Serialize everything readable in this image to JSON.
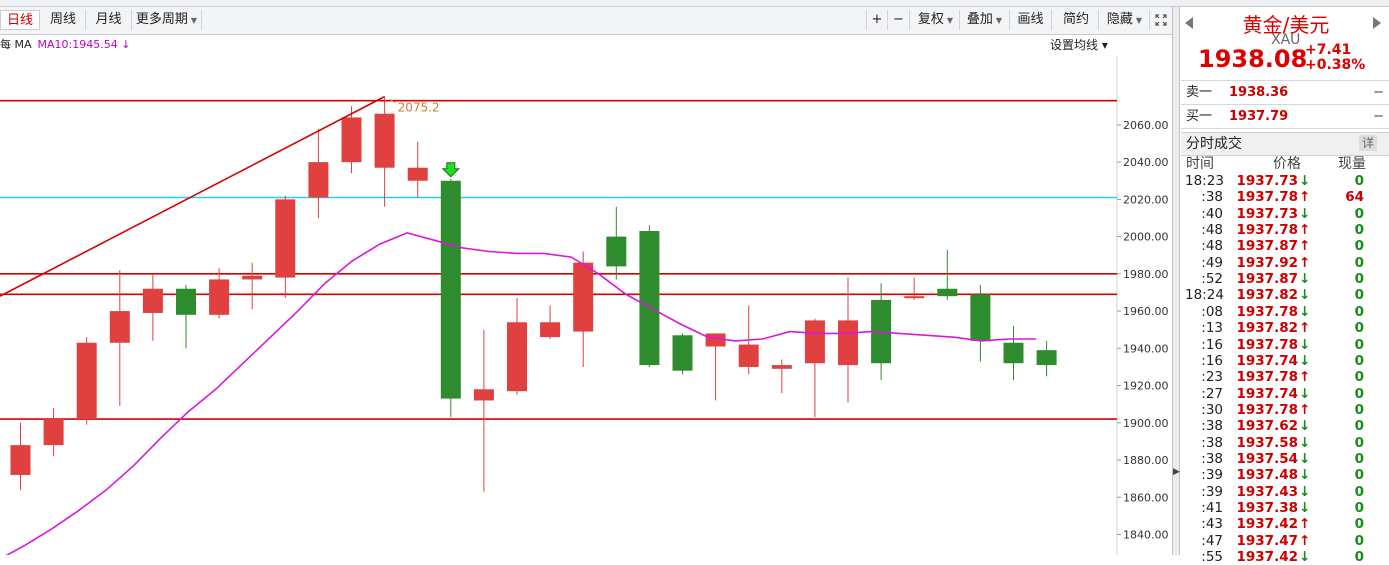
{
  "toolbar": {
    "tabs": [
      {
        "label": "日线",
        "active": true
      },
      {
        "label": "周线",
        "active": false
      },
      {
        "label": "月线",
        "active": false
      }
    ],
    "more_period": "更多周期",
    "zoom_in": "+",
    "zoom_out": "−",
    "fuquan": "复权",
    "diejia": "叠加",
    "draw": "画线",
    "simple": "简约",
    "hide": "隐藏"
  },
  "legend": {
    "prefix": "每 MA",
    "ma10": "MA10:1945.54 ↓"
  },
  "set_ma_label": "设置均线 ▾",
  "chart_data": {
    "type": "candlestick",
    "yaxis_ticks": [
      "2060.00",
      "2040.00",
      "2020.00",
      "2000.00",
      "1980.00",
      "1960.00",
      "1940.00",
      "1920.00",
      "1900.00",
      "1880.00",
      "1860.00",
      "1840.00"
    ],
    "ylim": [
      1829,
      2097
    ],
    "annotation_high": "2075.2",
    "candles": [
      {
        "o": 1872,
        "h": 1900,
        "l": 1864,
        "c": 1888
      },
      {
        "o": 1888,
        "h": 1908,
        "l": 1882,
        "c": 1902
      },
      {
        "o": 1902,
        "h": 1946,
        "l": 1899,
        "c": 1943
      },
      {
        "o": 1943,
        "h": 1982,
        "l": 1909,
        "c": 1960
      },
      {
        "o": 1959,
        "h": 1980,
        "l": 1944,
        "c": 1972
      },
      {
        "o": 1972,
        "h": 1974,
        "l": 1940,
        "c": 1958
      },
      {
        "o": 1958,
        "h": 1983,
        "l": 1956,
        "c": 1977
      },
      {
        "o": 1977,
        "h": 1986,
        "l": 1961,
        "c": 1979
      },
      {
        "o": 1978,
        "h": 2022,
        "l": 1967,
        "c": 2020
      },
      {
        "o": 2021,
        "h": 2058,
        "l": 2010,
        "c": 2040
      },
      {
        "o": 2040,
        "h": 2070,
        "l": 2034,
        "c": 2064
      },
      {
        "o": 2037,
        "h": 2075.2,
        "l": 2016,
        "c": 2066
      },
      {
        "o": 2030,
        "h": 2051,
        "l": 2021,
        "c": 2037
      },
      {
        "o": 2030,
        "h": 2031,
        "l": 1903,
        "c": 1913
      },
      {
        "o": 1912,
        "h": 1950,
        "l": 1863,
        "c": 1918
      },
      {
        "o": 1917,
        "h": 1967,
        "l": 1915,
        "c": 1954
      },
      {
        "o": 1946,
        "h": 1963,
        "l": 1945,
        "c": 1954
      },
      {
        "o": 1949,
        "h": 1992,
        "l": 1930,
        "c": 1986
      },
      {
        "o": 2000,
        "h": 2016,
        "l": 1977,
        "c": 1984
      },
      {
        "o": 2003,
        "h": 2006,
        "l": 1930,
        "c": 1931
      },
      {
        "o": 1947,
        "h": 1948,
        "l": 1926,
        "c": 1928
      },
      {
        "o": 1941,
        "h": 1948,
        "l": 1912,
        "c": 1948
      },
      {
        "o": 1930,
        "h": 1963,
        "l": 1926,
        "c": 1942
      },
      {
        "o": 1929,
        "h": 1934,
        "l": 1916,
        "c": 1931
      },
      {
        "o": 1932,
        "h": 1956,
        "l": 1903,
        "c": 1955
      },
      {
        "o": 1931,
        "h": 1978,
        "l": 1911,
        "c": 1955
      },
      {
        "o": 1966,
        "h": 1975,
        "l": 1923,
        "c": 1932
      },
      {
        "o": 1968,
        "h": 1978,
        "l": 1966,
        "c": 1968
      },
      {
        "o": 1972,
        "h": 1993,
        "l": 1966,
        "c": 1968
      },
      {
        "o": 1969,
        "h": 1974,
        "l": 1933,
        "c": 1944
      },
      {
        "o": 1943,
        "h": 1952,
        "l": 1923,
        "c": 1932
      },
      {
        "o": 1939,
        "h": 1944,
        "l": 1925,
        "c": 1931
      }
    ],
    "ma10": [
      1826,
      1834,
      1843,
      1853,
      1864,
      1877,
      1892,
      1906,
      1918,
      1932,
      1946,
      1960,
      1975,
      1987,
      1996,
      2002,
      1998,
      1994,
      1992,
      1991,
      1991,
      1989,
      1980,
      1969,
      1961,
      1953,
      1946,
      1944,
      1945,
      1949,
      1948,
      1948,
      1949,
      1948,
      1947,
      1946,
      1944,
      1945,
      1945
    ],
    "hlines": [
      2073,
      2021,
      1980,
      1969,
      1902
    ],
    "hline_colors": [
      "#d40000",
      "#21d5e6",
      "#d40000",
      "#d40000",
      "#d40000"
    ],
    "trendline": [
      1968,
      2075.2
    ]
  },
  "colors": {
    "up": "#e04040",
    "down": "#2e8b2e",
    "ma": "#d81ad8",
    "trend": "#d40000"
  },
  "panel": {
    "title": "黄金/美元",
    "code": "XAU",
    "price": "1938.08",
    "change": "+7.41",
    "change_pct": "+0.38%",
    "sell_label": "卖一",
    "sell_price": "1938.36",
    "sell_vol": "−",
    "buy_label": "买一",
    "buy_price": "1937.79",
    "buy_vol": "−",
    "trades_title": "分时成交",
    "detail": "详",
    "col_time": "时间",
    "col_price": "价格",
    "col_vol": "现量",
    "trades": [
      {
        "t": "18:23",
        "p": "1937.73",
        "d": "down",
        "v": "0"
      },
      {
        "t": ":38",
        "p": "1937.78",
        "d": "up",
        "v": "64"
      },
      {
        "t": ":40",
        "p": "1937.73",
        "d": "down",
        "v": "0"
      },
      {
        "t": ":48",
        "p": "1937.78",
        "d": "up",
        "v": "0"
      },
      {
        "t": ":48",
        "p": "1937.87",
        "d": "up",
        "v": "0"
      },
      {
        "t": ":49",
        "p": "1937.92",
        "d": "up",
        "v": "0"
      },
      {
        "t": ":52",
        "p": "1937.87",
        "d": "down",
        "v": "0"
      },
      {
        "t": "18:24",
        "p": "1937.82",
        "d": "down",
        "v": "0"
      },
      {
        "t": ":08",
        "p": "1937.78",
        "d": "down",
        "v": "0"
      },
      {
        "t": ":13",
        "p": "1937.82",
        "d": "up",
        "v": "0"
      },
      {
        "t": ":16",
        "p": "1937.78",
        "d": "down",
        "v": "0"
      },
      {
        "t": ":16",
        "p": "1937.74",
        "d": "down",
        "v": "0"
      },
      {
        "t": ":23",
        "p": "1937.78",
        "d": "up",
        "v": "0"
      },
      {
        "t": ":27",
        "p": "1937.74",
        "d": "down",
        "v": "0"
      },
      {
        "t": ":30",
        "p": "1937.78",
        "d": "up",
        "v": "0"
      },
      {
        "t": ":38",
        "p": "1937.62",
        "d": "down",
        "v": "0"
      },
      {
        "t": ":38",
        "p": "1937.58",
        "d": "down",
        "v": "0"
      },
      {
        "t": ":38",
        "p": "1937.54",
        "d": "down",
        "v": "0"
      },
      {
        "t": ":39",
        "p": "1937.48",
        "d": "down",
        "v": "0"
      },
      {
        "t": ":39",
        "p": "1937.43",
        "d": "down",
        "v": "0"
      },
      {
        "t": ":41",
        "p": "1937.38",
        "d": "down",
        "v": "0"
      },
      {
        "t": ":43",
        "p": "1937.42",
        "d": "up",
        "v": "0"
      },
      {
        "t": ":47",
        "p": "1937.47",
        "d": "up",
        "v": "0"
      },
      {
        "t": ":55",
        "p": "1937.42",
        "d": "down",
        "v": "0"
      }
    ]
  }
}
